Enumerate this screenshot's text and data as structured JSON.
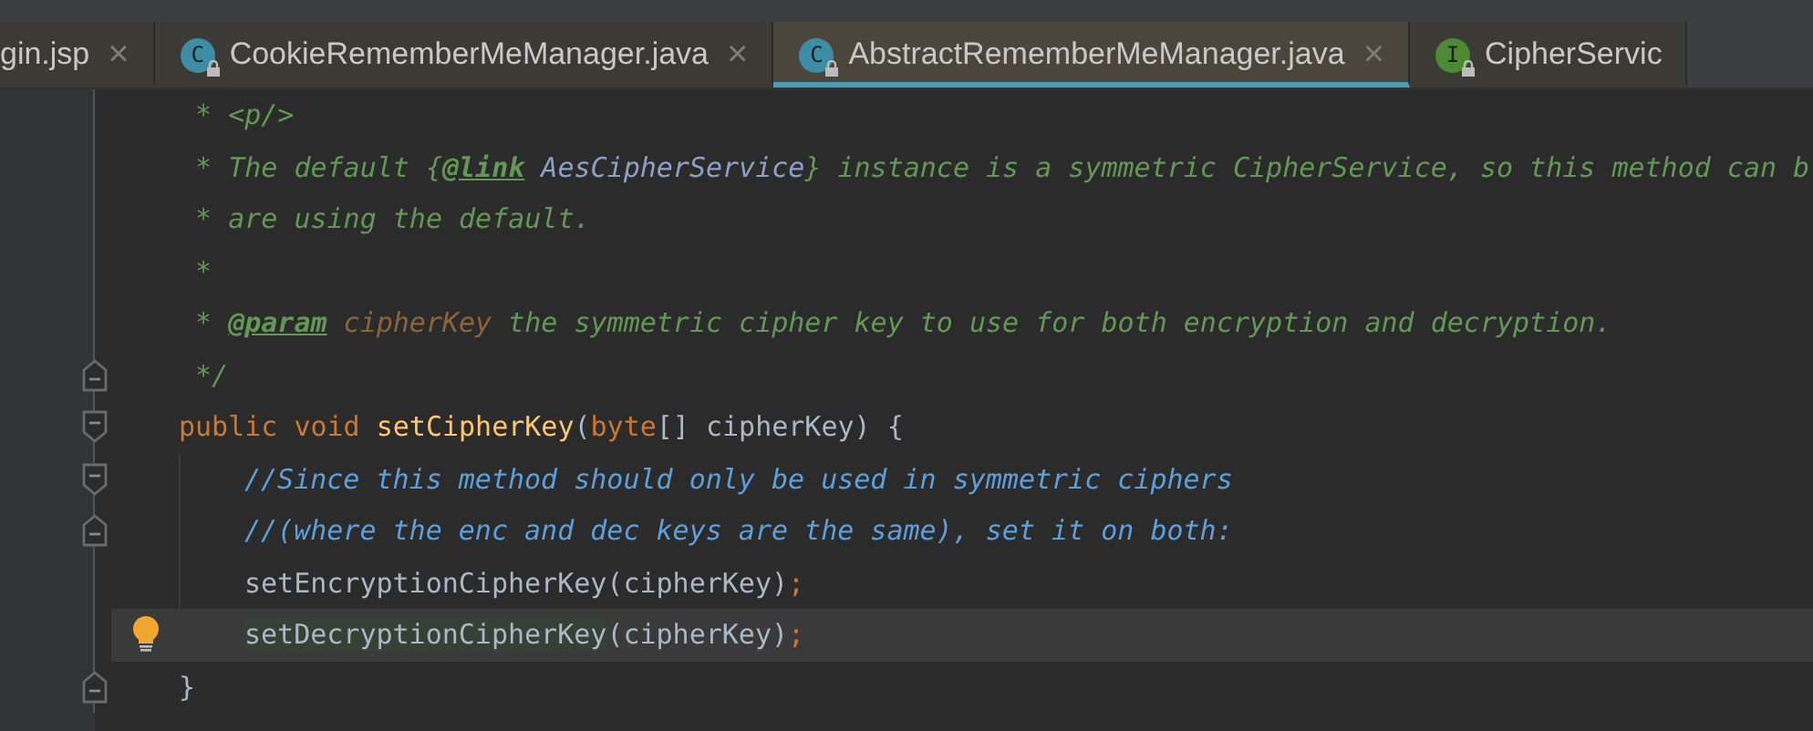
{
  "tabs": [
    {
      "label": "gin.jsp",
      "close": "×",
      "selected": false
    },
    {
      "label": "CookieRememberMeManager.java",
      "kind": "class",
      "icon_letter": "C",
      "locked": true,
      "close": "×",
      "selected": false
    },
    {
      "label": "AbstractRememberMeManager.java",
      "kind": "class",
      "icon_letter": "C",
      "locked": true,
      "close": "×",
      "selected": true
    },
    {
      "label": "CipherServic",
      "kind": "interface",
      "icon_letter": "I",
      "locked": true,
      "selected": false
    }
  ],
  "lines": [
    {
      "fold_start": false,
      "fold_end": false,
      "current": false,
      "bulb": false,
      "tokens": [
        {
          "kind": "doc",
          "text": " * <p/>"
        }
      ]
    },
    {
      "fold_start": false,
      "fold_end": false,
      "current": false,
      "bulb": false,
      "tokens": [
        {
          "kind": "doc",
          "text": " * The default {"
        },
        {
          "kind": "doctag",
          "text": "@link"
        },
        {
          "kind": "doclink",
          "text": " AesCipherService"
        },
        {
          "kind": "doc",
          "text": "} instance is a symmetric CipherService, so this method can b"
        }
      ]
    },
    {
      "fold_start": false,
      "fold_end": false,
      "current": false,
      "bulb": false,
      "tokens": [
        {
          "kind": "doc",
          "text": " * are using the default."
        }
      ]
    },
    {
      "fold_start": false,
      "fold_end": false,
      "current": false,
      "bulb": false,
      "tokens": [
        {
          "kind": "doc",
          "text": " *"
        }
      ]
    },
    {
      "fold_start": false,
      "fold_end": false,
      "current": false,
      "bulb": false,
      "tokens": [
        {
          "kind": "doc",
          "text": " * "
        },
        {
          "kind": "doctag",
          "text": "@param"
        },
        {
          "kind": "param",
          "text": " cipherKey"
        },
        {
          "kind": "doc",
          "text": " the symmetric cipher key to use for both encryption and decryption."
        }
      ]
    },
    {
      "fold_start": false,
      "fold_end": true,
      "current": false,
      "bulb": false,
      "tokens": [
        {
          "kind": "doc",
          "text": " */"
        }
      ]
    },
    {
      "fold_start": true,
      "fold_end": false,
      "current": false,
      "bulb": false,
      "tokens": [
        {
          "kind": "keyword",
          "text": "public void "
        },
        {
          "kind": "method",
          "text": "setCipherKey"
        },
        {
          "kind": "plain",
          "text": "("
        },
        {
          "kind": "keyword",
          "text": "byte"
        },
        {
          "kind": "plain",
          "text": "[] cipherKey) {"
        }
      ],
      "children": [
        {
          "fold_start": true,
          "fold_end": false,
          "current": false,
          "bulb": false,
          "tokens": [
            {
              "kind": "comment",
              "text": "//Since this method should only be used in symmetric ciphers"
            }
          ]
        },
        {
          "fold_start": false,
          "fold_end": true,
          "current": false,
          "bulb": false,
          "tokens": [
            {
              "kind": "comment",
              "text": "//(where the enc and dec keys are the same), set it on both:"
            }
          ]
        },
        {
          "fold_start": false,
          "fold_end": false,
          "current": false,
          "bulb": false,
          "tokens": [
            {
              "kind": "plain",
              "text": "setEncryptionCipherKey(cipherKey)"
            },
            {
              "kind": "keyword",
              "text": ";"
            }
          ]
        },
        {
          "fold_start": false,
          "fold_end": false,
          "current": true,
          "bulb": true,
          "tokens": [
            {
              "kind": "usage",
              "text": "setDecryptionCipherKey"
            },
            {
              "kind": "plain",
              "text": "(cipherKey)"
            },
            {
              "kind": "keyword",
              "text": ";"
            }
          ]
        }
      ]
    },
    {
      "fold_start": false,
      "fold_end": true,
      "current": false,
      "bulb": false,
      "tokens": [
        {
          "kind": "plain",
          "text": "}"
        }
      ]
    }
  ]
}
